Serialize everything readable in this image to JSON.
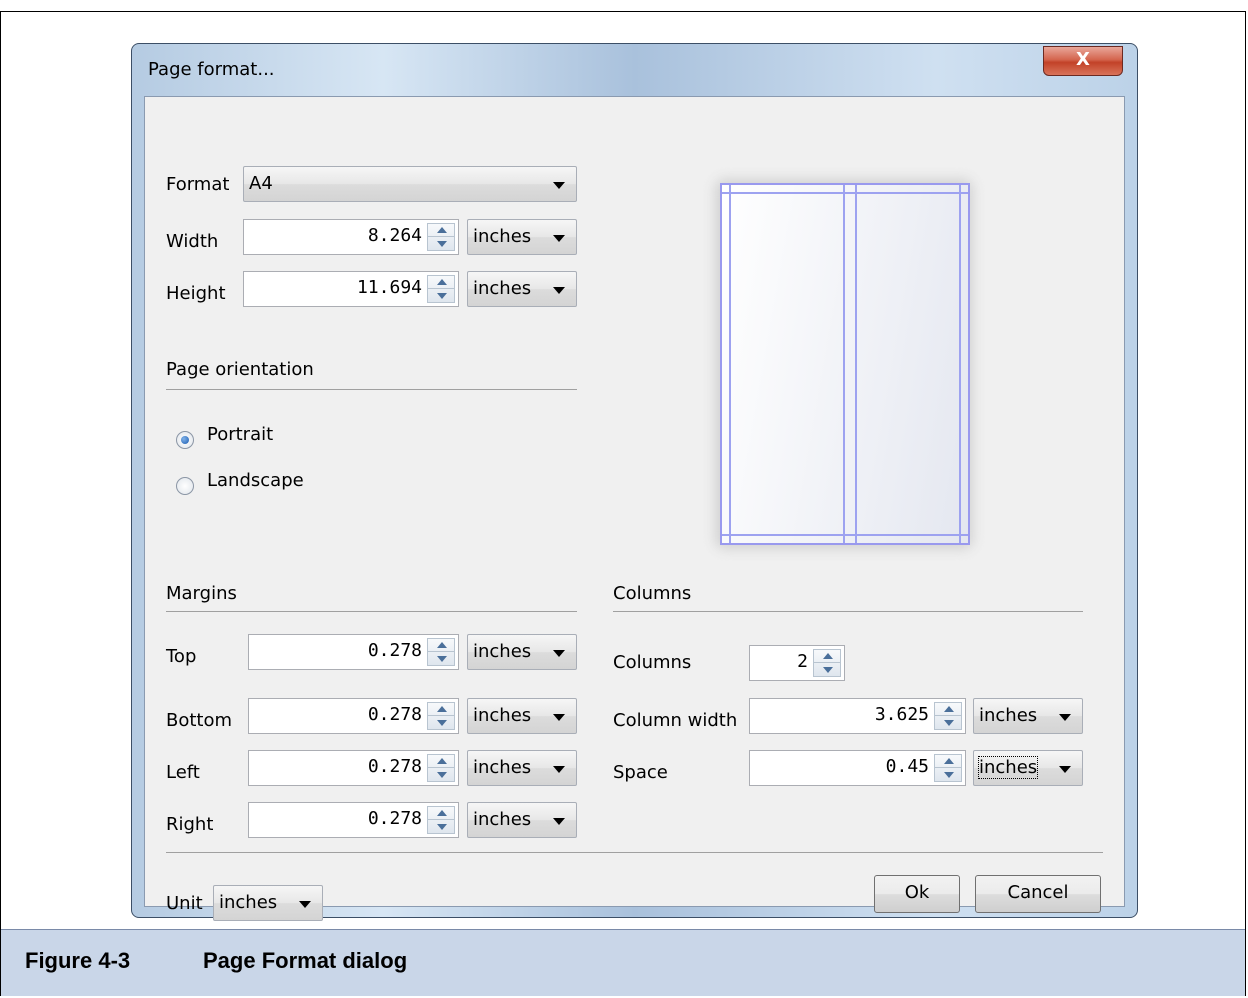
{
  "window": {
    "title": "Page format...",
    "close_label": "X"
  },
  "format": {
    "label": "Format",
    "value": "A4"
  },
  "width": {
    "label": "Width",
    "value": "8.264",
    "unit": "inches"
  },
  "height": {
    "label": "Height",
    "value": "11.694",
    "unit": "inches"
  },
  "orientation": {
    "heading": "Page orientation",
    "options": [
      {
        "label": "Portrait",
        "selected": true
      },
      {
        "label": "Landscape",
        "selected": false
      }
    ]
  },
  "margins": {
    "heading": "Margins",
    "top": {
      "label": "Top",
      "value": "0.278",
      "unit": "inches"
    },
    "bottom": {
      "label": "Bottom",
      "value": "0.278",
      "unit": "inches"
    },
    "left": {
      "label": "Left",
      "value": "0.278",
      "unit": "inches"
    },
    "right": {
      "label": "Right",
      "value": "0.278",
      "unit": "inches"
    }
  },
  "columns": {
    "heading": "Columns",
    "count": {
      "label": "Columns",
      "value": "2"
    },
    "width": {
      "label": "Column width",
      "value": "3.625",
      "unit": "inches"
    },
    "space": {
      "label": "Space",
      "value": "0.45",
      "unit": "inches"
    }
  },
  "unit": {
    "label": "Unit",
    "value": "inches"
  },
  "buttons": {
    "ok": "Ok",
    "cancel": "Cancel"
  },
  "caption": {
    "number": "Figure 4-3",
    "text": "Page Format dialog"
  },
  "colors": {
    "preview_lines": "#9da2f0",
    "caption_bg": "#c9d6e8",
    "close_button": "#c24228"
  }
}
